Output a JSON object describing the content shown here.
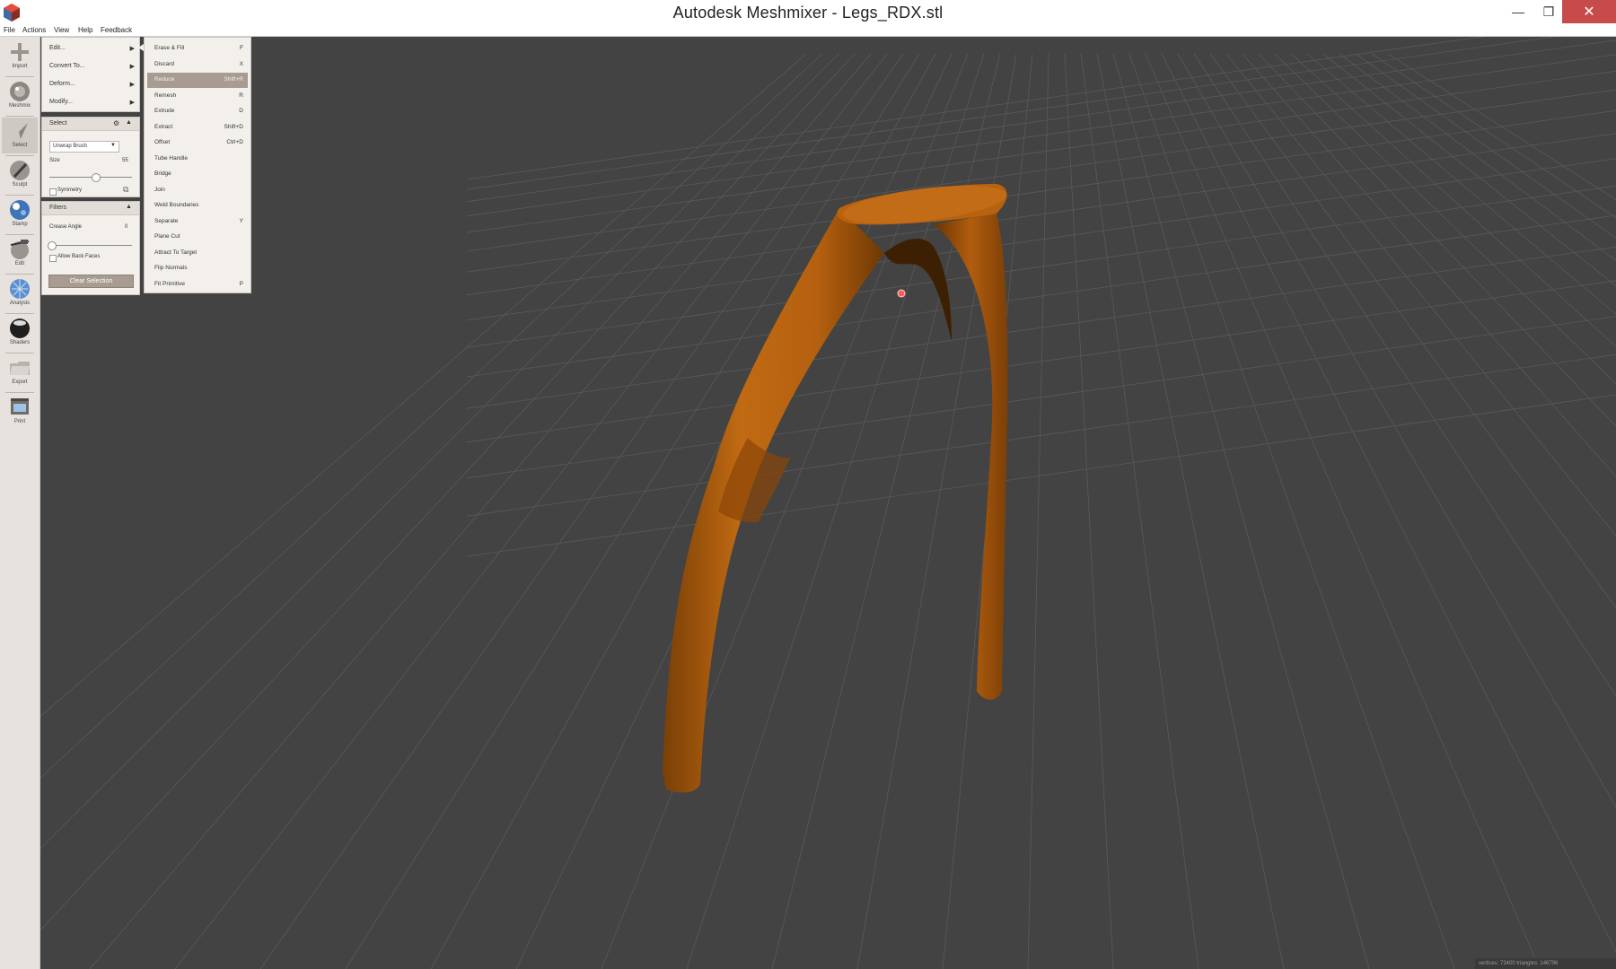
{
  "window": {
    "title": "Autodesk Meshmixer - Legs_RDX.stl",
    "minimize_glyph": "—",
    "restore_glyph": "❐",
    "close_glyph": "✕"
  },
  "menu": [
    "File",
    "Actions",
    "View",
    "Help",
    "Feedback"
  ],
  "toolbar": {
    "tools": [
      {
        "label": "Import",
        "icon": "plus-icon"
      },
      {
        "label": "Meshmix",
        "icon": "meshmix-icon"
      },
      {
        "label": "Select",
        "icon": "select-arrow-icon",
        "active": true
      },
      {
        "label": "Sculpt",
        "icon": "brush-icon"
      },
      {
        "label": "Stamp",
        "icon": "stamp-icon"
      },
      {
        "label": "Edit",
        "icon": "edit-icon"
      },
      {
        "label": "Analysis",
        "icon": "analysis-icon"
      },
      {
        "label": "Shaders",
        "icon": "sphere-icon"
      },
      {
        "label": "Export",
        "icon": "folder-icon"
      },
      {
        "label": "Print",
        "icon": "printer-icon"
      }
    ]
  },
  "actions_panel": {
    "items": [
      {
        "label": "Edit...",
        "arrow": "▶"
      },
      {
        "label": "Convert To...",
        "arrow": "▶"
      },
      {
        "label": "Deform...",
        "arrow": "▶"
      },
      {
        "label": "Modify...",
        "arrow": "▶"
      }
    ]
  },
  "select_panel": {
    "title": "Select",
    "gear": "⚙",
    "collapse": "▲",
    "brush_type": "Unwrap Brush",
    "dropdown_arrow": "▼",
    "size_label": "Size",
    "size_value": "55",
    "size_slider_fraction": 0.55,
    "symmetry_label": "Symmetry"
  },
  "filters_panel": {
    "title": "Filters",
    "collapse": "▲",
    "crease_angle_label": "Crease Angle",
    "crease_angle_value": "0",
    "crease_slider_fraction": 0.0,
    "allow_back_faces_label": "Allow Back Faces",
    "clear_selection_label": "Clear Selection"
  },
  "edit_submenu": {
    "items": [
      {
        "label": "Erase & Fill",
        "shortcut": "F"
      },
      {
        "label": "Discard",
        "shortcut": "X"
      },
      {
        "label": "Reduce",
        "shortcut": "Shift+R",
        "highlighted": true
      },
      {
        "label": "Remesh",
        "shortcut": "R"
      },
      {
        "label": "Extrude",
        "shortcut": "D"
      },
      {
        "label": "Extract",
        "shortcut": "Shift+D"
      },
      {
        "label": "Offset",
        "shortcut": "Ctrl+D"
      },
      {
        "label": "Tube Handle",
        "shortcut": ""
      },
      {
        "label": "Bridge",
        "shortcut": ""
      },
      {
        "label": "Join",
        "shortcut": ""
      },
      {
        "label": "Weld Boundaries",
        "shortcut": ""
      },
      {
        "label": "Separate",
        "shortcut": "Y"
      },
      {
        "label": "Plane Cut",
        "shortcut": ""
      },
      {
        "label": "Attract To Target",
        "shortcut": ""
      },
      {
        "label": "Flip Normals",
        "shortcut": ""
      },
      {
        "label": "Fit Primitive",
        "shortcut": "P"
      }
    ]
  },
  "status": {
    "text": "vertices: 73400 triangles: 146796"
  },
  "colors": {
    "viewport_bg": "#434343",
    "mesh": "#b8620f",
    "selection_highlight": "#a89c92",
    "close_button": "#c74b4b"
  }
}
